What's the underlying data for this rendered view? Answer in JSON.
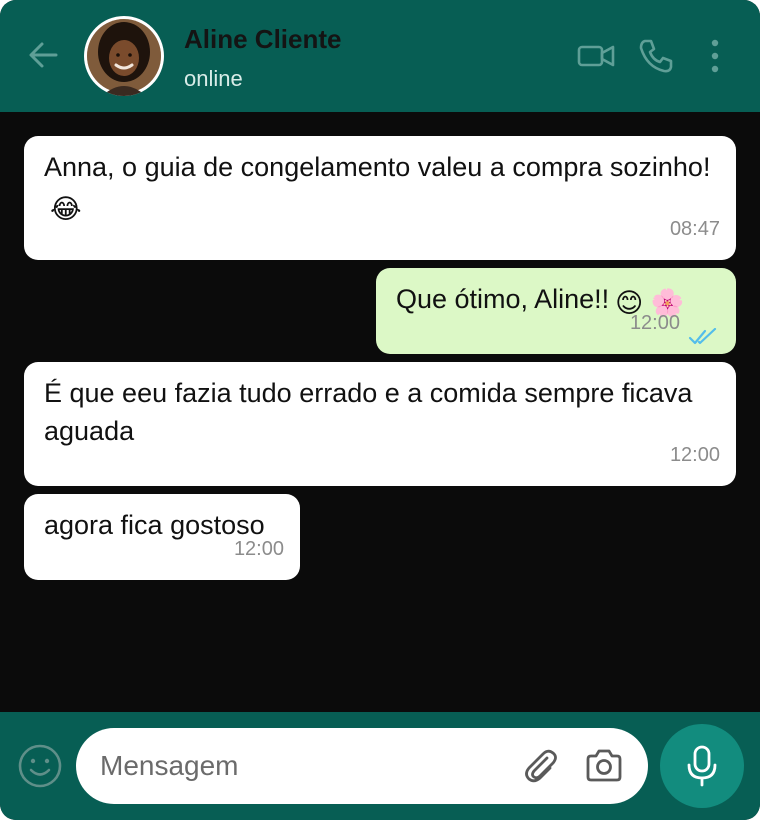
{
  "header": {
    "contact_name": "Aline Cliente",
    "status": "online",
    "icons": [
      "back-arrow-icon",
      "avatar",
      "video-call-icon",
      "phone-icon",
      "more-vert-icon"
    ]
  },
  "messages": [
    {
      "direction": "incoming",
      "text": "Anna, o guia de congelamento valeu a compra sozinho!",
      "emoji": "😂",
      "time": "08:47"
    },
    {
      "direction": "outgoing",
      "text": "Que ótimo, Aline!!",
      "emoji": "😊 🌸",
      "time": "12:00",
      "status": "read"
    },
    {
      "direction": "incoming",
      "text": "É que eeu fazia tudo errado e a comida sempre ficava aguada",
      "time": "12:00"
    },
    {
      "direction": "incoming",
      "text": "agora fica gostoso",
      "time": "12:00"
    }
  ],
  "composer": {
    "placeholder": "Mensagem",
    "icons": [
      "emoji-icon",
      "attach-icon",
      "camera-icon",
      "mic-icon"
    ]
  },
  "colors": {
    "header_bg": "#075e54",
    "chat_bg": "#0b0b0b",
    "incoming_bubble": "#ffffff",
    "outgoing_bubble": "#dcf8c6",
    "mic_button": "#128c7e",
    "read_ticks": "#53bdeb"
  }
}
